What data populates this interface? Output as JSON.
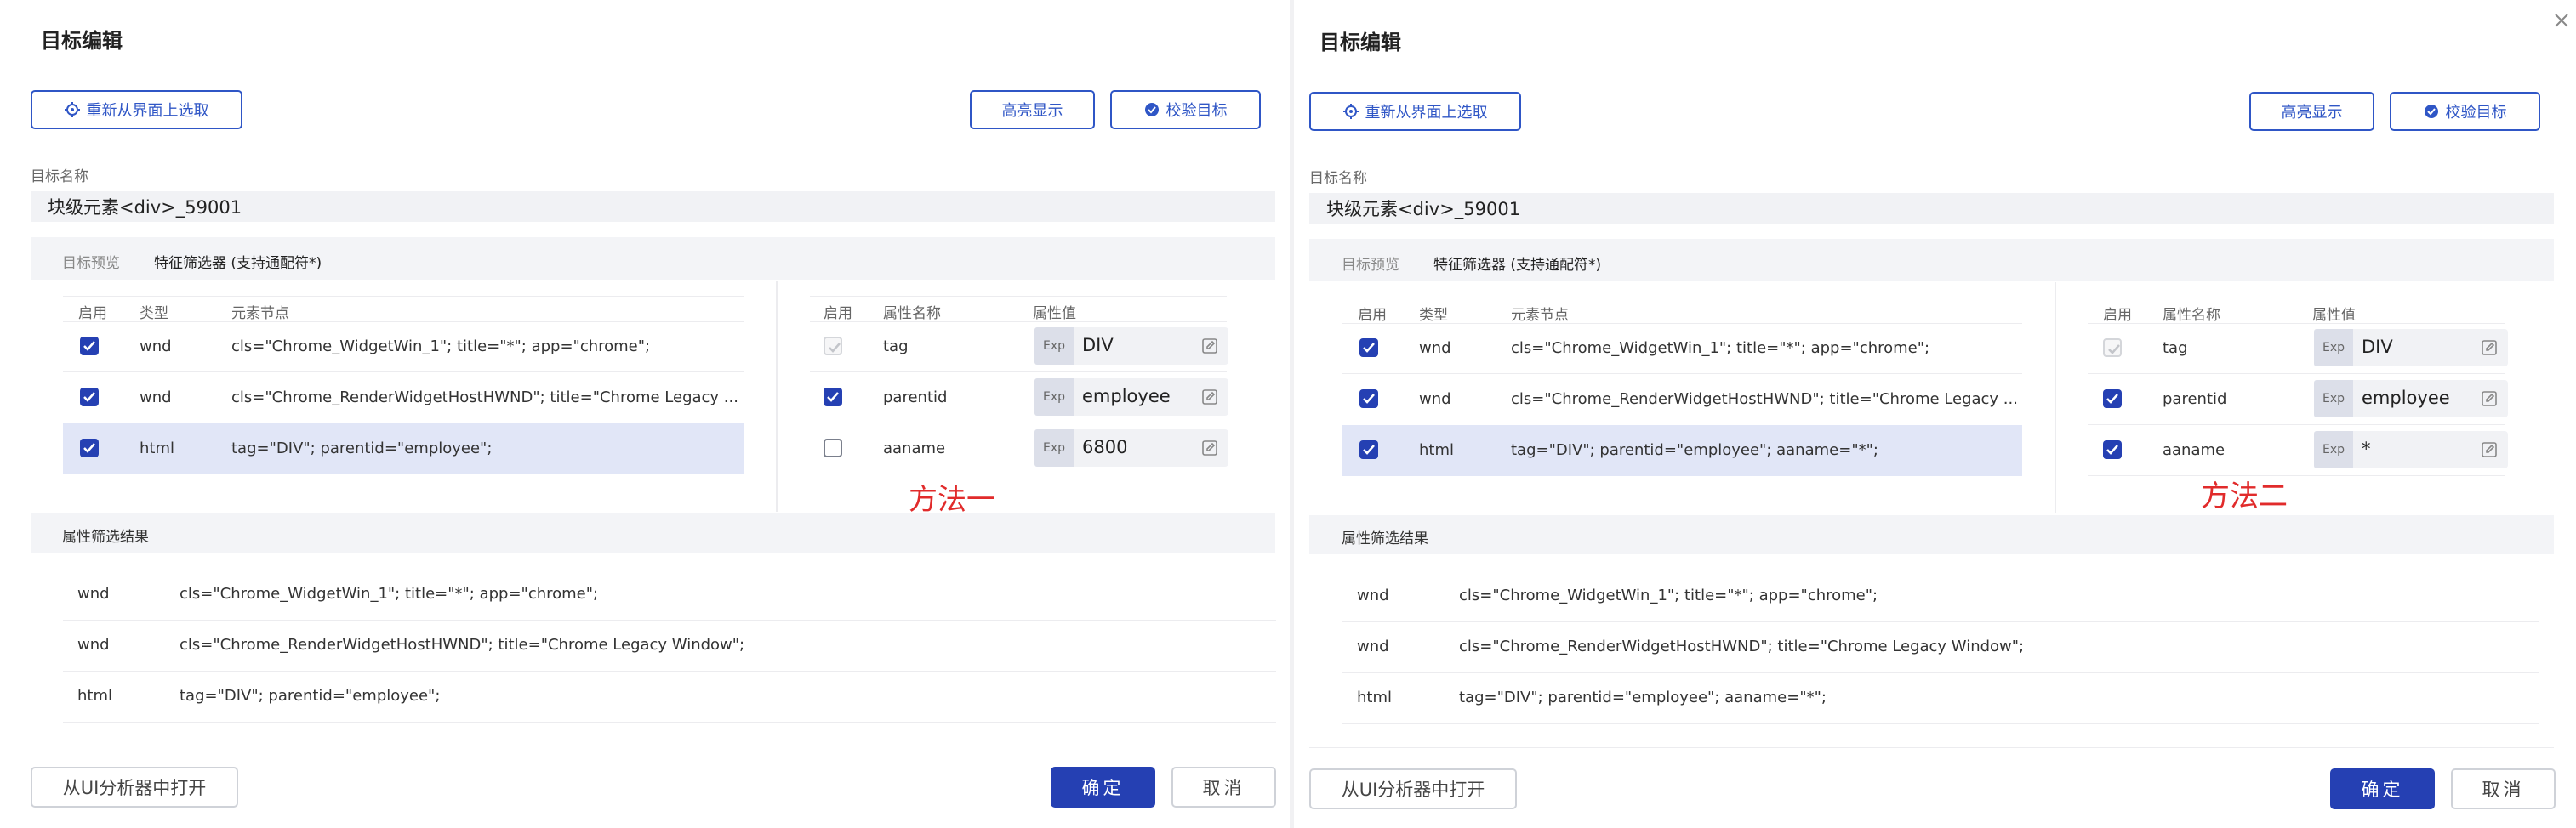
{
  "left": {
    "title": "目标编辑",
    "reselect_label": "重新从界面上选取",
    "highlight_label": "高亮显示",
    "verify_label": "校验目标",
    "name_label": "目标名称",
    "name_value": "块级元素<div>_59001",
    "tabs": [
      {
        "label": "目标预览"
      },
      {
        "label": "特征筛选器 (支持通配符*)"
      }
    ],
    "node_headers": {
      "enable": "启用",
      "type": "类型",
      "node": "元素节点"
    },
    "nodes": [
      {
        "type": "wnd",
        "node": "cls=\"Chrome_WidgetWin_1\"; title=\"*\"; app=\"chrome\";"
      },
      {
        "type": "wnd",
        "node": "cls=\"Chrome_RenderWidgetHostHWND\"; title=\"Chrome Legacy ..."
      },
      {
        "type": "html",
        "node": "tag=\"DIV\"; parentid=\"employee\";"
      }
    ],
    "attr_headers": {
      "enable": "启用",
      "name": "属性名称",
      "value": "属性值"
    },
    "attrs": [
      {
        "name": "tag",
        "exp": "Exp",
        "value": "DIV",
        "state": "disabled"
      },
      {
        "name": "parentid",
        "exp": "Exp",
        "value": "employee",
        "state": "checked"
      },
      {
        "name": "aaname",
        "exp": "Exp",
        "value": "6800",
        "state": "unchecked"
      }
    ],
    "method_label": "方法一",
    "result_title": "属性筛选结果",
    "results": [
      {
        "type": "wnd",
        "value": "cls=\"Chrome_WidgetWin_1\"; title=\"*\"; app=\"chrome\";"
      },
      {
        "type": "wnd",
        "value": "cls=\"Chrome_RenderWidgetHostHWND\"; title=\"Chrome Legacy Window\";"
      },
      {
        "type": "html",
        "value": "tag=\"DIV\"; parentid=\"employee\";"
      }
    ],
    "open_analyzer_label": "从UI分析器中打开",
    "ok_label": "确定",
    "cancel_label": "取消"
  },
  "right": {
    "title": "目标编辑",
    "reselect_label": "重新从界面上选取",
    "highlight_label": "高亮显示",
    "verify_label": "校验目标",
    "name_label": "目标名称",
    "name_value": "块级元素<div>_59001",
    "tabs": [
      {
        "label": "目标预览"
      },
      {
        "label": "特征筛选器 (支持通配符*)"
      }
    ],
    "node_headers": {
      "enable": "启用",
      "type": "类型",
      "node": "元素节点"
    },
    "nodes": [
      {
        "type": "wnd",
        "node": "cls=\"Chrome_WidgetWin_1\"; title=\"*\"; app=\"chrome\";"
      },
      {
        "type": "wnd",
        "node": "cls=\"Chrome_RenderWidgetHostHWND\"; title=\"Chrome Legacy ..."
      },
      {
        "type": "html",
        "node": "tag=\"DIV\"; parentid=\"employee\"; aaname=\"*\";"
      }
    ],
    "attr_headers": {
      "enable": "启用",
      "name": "属性名称",
      "value": "属性值"
    },
    "attrs": [
      {
        "name": "tag",
        "exp": "Exp",
        "value": "DIV",
        "state": "disabled"
      },
      {
        "name": "parentid",
        "exp": "Exp",
        "value": "employee",
        "state": "checked"
      },
      {
        "name": "aaname",
        "exp": "Exp",
        "value": "*",
        "state": "checked"
      }
    ],
    "method_label": "方法二",
    "result_title": "属性筛选结果",
    "results": [
      {
        "type": "wnd",
        "value": "cls=\"Chrome_WidgetWin_1\"; title=\"*\"; app=\"chrome\";"
      },
      {
        "type": "wnd",
        "value": "cls=\"Chrome_RenderWidgetHostHWND\"; title=\"Chrome Legacy Window\";"
      },
      {
        "type": "html",
        "value": "tag=\"DIV\"; parentid=\"employee\"; aaname=\"*\";"
      }
    ],
    "open_analyzer_label": "从UI分析器中打开",
    "ok_label": "确定",
    "cancel_label": "取消"
  },
  "colors": {
    "primary": "#2540b3",
    "method_text": "#e12b2b",
    "selected_row": "#e1e6f7"
  }
}
